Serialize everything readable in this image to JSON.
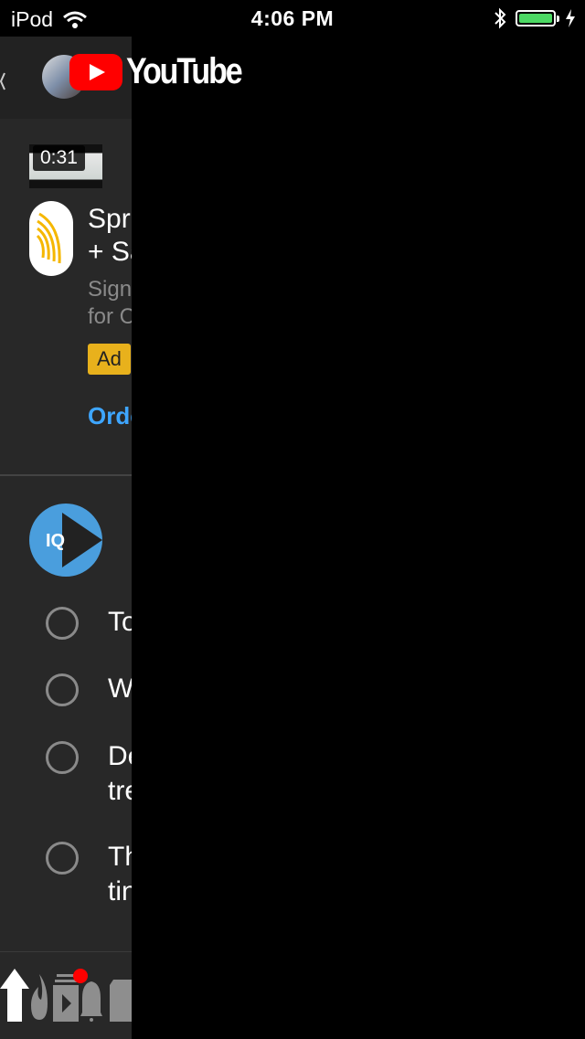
{
  "status_bar": {
    "carrier": "iPod",
    "time": "4:06 PM"
  },
  "header": {
    "logo_text": "YouTube"
  },
  "ad_card": {
    "duration": "0:31",
    "title": "Spr\n+ Sa",
    "subtitle": "Sign\nfor C",
    "badge": "Ad",
    "cta": "Orde"
  },
  "poll_card": {
    "channel_logo_text": "IQ",
    "options": [
      {
        "text": "To"
      },
      {
        "text": "W"
      },
      {
        "text": "De\ntre"
      },
      {
        "text": "Th\ntin"
      }
    ]
  },
  "colors": {
    "accent_link": "#3ea6ff",
    "badge": "#e8b11c",
    "battery": "#4cd964",
    "logo_red": "#ff0000"
  },
  "bottom_nav": {
    "items": [
      "home-icon",
      "trending-icon",
      "subscriptions-icon",
      "notifications-icon",
      "library-icon"
    ]
  }
}
